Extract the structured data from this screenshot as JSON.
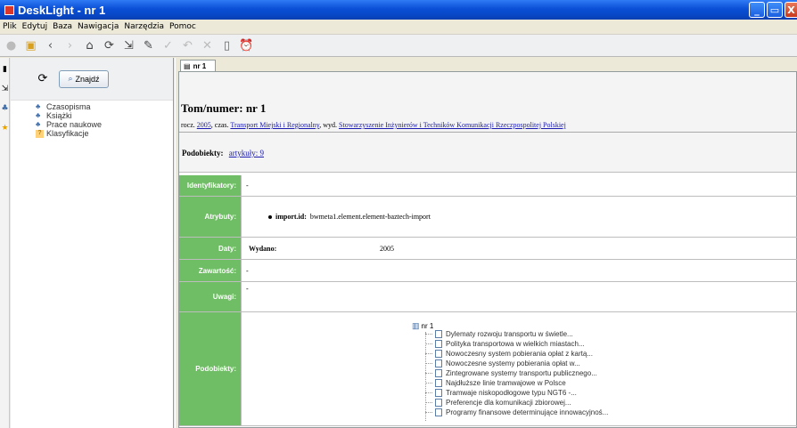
{
  "window": {
    "title": "DeskLight - nr 1",
    "controls": [
      "_",
      "▭",
      "X"
    ]
  },
  "menu": [
    "Plik",
    "Edytuj",
    "Baza",
    "Nawigacja",
    "Narzędzia",
    "Pomoc"
  ],
  "toolbar_icons": [
    "stop-icon",
    "open-icon",
    "back-icon",
    "forward-icon",
    "home-icon",
    "refresh-icon",
    "export-icon",
    "edit-icon",
    "check-icon",
    "undo-icon",
    "delete-icon",
    "new-icon",
    "alarm-icon"
  ],
  "left_panel": {
    "find_label": "Znajdź",
    "tree": [
      {
        "label": "Czasopisma",
        "icon": "collection-icon"
      },
      {
        "label": "Książki",
        "icon": "collection-icon"
      },
      {
        "label": "Prace naukowe",
        "icon": "collection-icon"
      },
      {
        "label": "Klasyfikacje",
        "icon": "question-icon"
      }
    ]
  },
  "tab": {
    "label": "nr 1"
  },
  "header": {
    "title": "Tom/numer: nr 1",
    "rocz_label": "rocz.",
    "year": "2005",
    "czas_label": "czas.",
    "journal": "Transport Miejski i Regionalny",
    "wyd_label": "wyd.",
    "publisher": "Stowarzyszenie Inżynierów i Techników Komunikacji Rzeczpospolitej Polskiej",
    "podobiekty_label": "Podobiekty:",
    "podobiekty_link": "artykuły: 9"
  },
  "details": {
    "identyfikatory": {
      "label": "Identyfikatory:",
      "value": "-"
    },
    "atrybuty": {
      "label": "Atrybuty:",
      "key": "import.id:",
      "value": "bwmeta1.element.element-baztech-import"
    },
    "daty": {
      "label": "Daty:",
      "key": "Wydano:",
      "value": "2005"
    },
    "zawartosc": {
      "label": "Zawartość:",
      "value": "-"
    },
    "uwagi": {
      "label": "Uwagi:",
      "value": "-"
    },
    "podobiekty": {
      "label": "Podobiekty:",
      "root": "nr 1",
      "items": [
        "Dylematy rozwoju transportu w świetle...",
        "Polityka transportowa w wielkich miastach...",
        "Nowoczesny system pobierania opłat z kartą...",
        "Nowoczesne systemy pobierania opłat w...",
        "Zintegrowane systemy transportu publicznego...",
        "Najdłuższe linie tramwajowe w Polsce",
        "Tramwaje niskopodłogowe typu NGT6 -...",
        "Preferencje dla komunikacji zbiorowej...",
        "Programy finansowe determinujące innowacyjnoś..."
      ]
    }
  }
}
